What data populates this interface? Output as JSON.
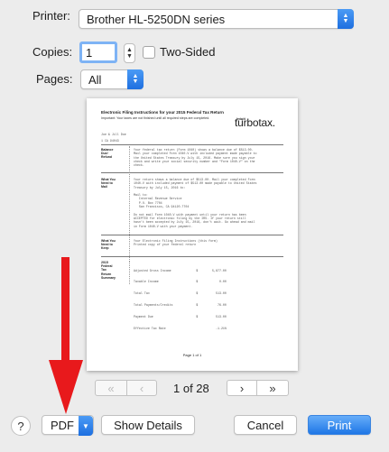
{
  "printer": {
    "label": "Printer:",
    "value": "Brother HL-5250DN series"
  },
  "copies": {
    "label": "Copies:",
    "value": "1",
    "two_sided_label": "Two-Sided"
  },
  "pages": {
    "label": "Pages:",
    "value": "All"
  },
  "preview": {
    "title": "Electronic Filing Instructions for your 2015 Federal Tax Return",
    "subtitle": "Important: Your taxes are not finished until all required steps are completed.",
    "logo_small": "intuit",
    "logo": "turbotax.",
    "header_lines": [
      "Joe & Jill Doe",
      "1 CA 94043"
    ],
    "sections": [
      {
        "heading": [
          "Balance",
          "Due/",
          "Refund"
        ],
        "lines": [
          "Your federal tax return (Form 1040) shows a balance due of $513.00.",
          "Mail your completed Form 1040-V with included payment made payable to",
          "the United States Treasury by July 15, 2016. Make sure you sign your",
          "check and write your social security number and \"Form 1040-V\" on the",
          "check."
        ]
      },
      {
        "heading": [
          "What You",
          "Need to",
          "Mail"
        ],
        "lines": [
          "Your return shows a balance due of $513.00. Mail your completed Form",
          "1040-V with included payment of $513.00 made payable to United States",
          "Treasury by July 15, 2016 to:",
          "",
          "Mail to:",
          "   Internal Revenue Service",
          "   P.O. Box 7704",
          "   San Francisco, CA 94120-7704",
          "",
          "Do not mail Form 1040-V with payment until your return has been",
          "ACCEPTED for electronic filing by the IRS. If your return still",
          "hasn't been accepted by July 15, 2016, don't wait. Go ahead and mail",
          "in Form 1040-V with your payment."
        ]
      },
      {
        "heading": [
          "What You",
          "Need to",
          "Keep"
        ],
        "lines": [
          "Your Electronic Filing Instructions (this form)",
          "Printed copy of your federal return"
        ]
      },
      {
        "heading": [
          "2015",
          "Federal",
          "Tax",
          "Return",
          "Summary"
        ],
        "lines": [
          "Adjusted Gross Income              $        5,877.00",
          "Taxable Income                     $            0.00",
          "Total Tax                          $          513.00",
          "Total Payments/Credits             $           76.00",
          "Payment Due                        $          513.00",
          "Effective Tax Rate                            -1.21%"
        ]
      }
    ],
    "footer": "Page 1 of 1"
  },
  "pager": {
    "current": "1 of 28"
  },
  "buttons": {
    "help": "?",
    "pdf": "PDF",
    "show_details": "Show Details",
    "cancel": "Cancel",
    "print": "Print"
  },
  "annotation": {
    "arrow_color": "#e8191c"
  },
  "colors": {
    "accent": "#1e76e6",
    "background": "#ececec"
  }
}
